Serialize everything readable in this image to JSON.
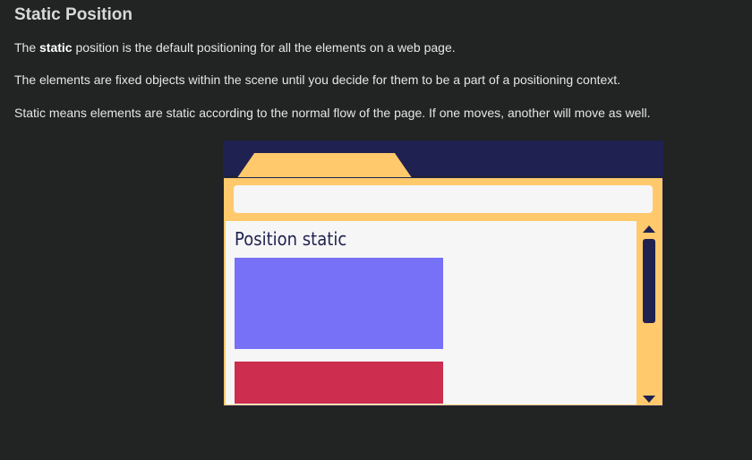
{
  "article": {
    "title": "Static Position",
    "p1_before": "The ",
    "p1_bold": "static",
    "p1_after": " position is the default positioning for all the elements on a web page.",
    "p2": "The elements are fixed objects within the scene until you decide for them to be a part of a positioning context.",
    "p3": "Static means elements are static according to the normal flow of the page. If one moves, another will move as well."
  },
  "illustration": {
    "heading": "Position static",
    "icons": {
      "scroll_up": "triangle-up-icon",
      "scroll_down": "triangle-down-icon"
    },
    "colors": {
      "browser_top": "#1f2150",
      "frame": "#ffc96c",
      "viewport": "#f6f6f6",
      "box_1": "#7671f7",
      "box_2": "#cd2d4f"
    }
  }
}
